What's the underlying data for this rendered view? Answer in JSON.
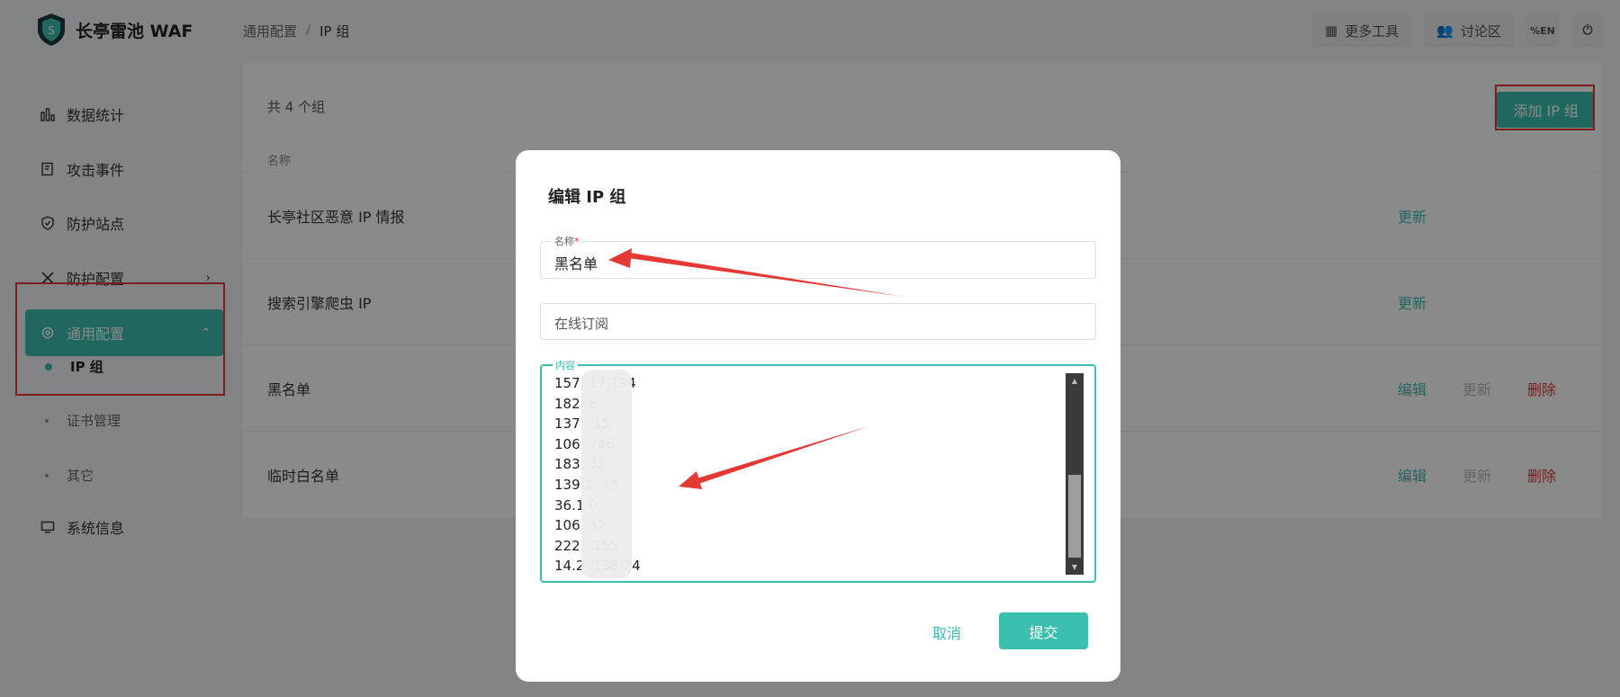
{
  "header": {
    "app_name": "长亭雷池 WAF",
    "breadcrumb": [
      "通用配置",
      "IP 组"
    ],
    "tools": [
      {
        "label": "更多工具",
        "icon": "apps-icon"
      },
      {
        "label": "讨论区",
        "icon": "community-icon"
      }
    ],
    "lang_icon": "%EN",
    "logout_icon": "logout-icon"
  },
  "sidebar": {
    "items": [
      {
        "label": "数据统计",
        "icon": "chart-icon"
      },
      {
        "label": "攻击事件",
        "icon": "event-icon"
      },
      {
        "label": "防护站点",
        "icon": "shield-icon"
      },
      {
        "label": "防护配置",
        "icon": "tools-icon"
      },
      {
        "label": "通用配置",
        "icon": "settings-icon"
      },
      {
        "label": "系统信息",
        "icon": "monitor-icon"
      }
    ],
    "sub_items": [
      "IP 组",
      "证书管理",
      "其它"
    ]
  },
  "main": {
    "count_text": "共 4 个组",
    "add_button": "添加 IP 组",
    "column_name": "名称",
    "rows": [
      {
        "name": "长亭社区恶意 IP 情报",
        "update": "更新"
      },
      {
        "name": "搜索引擎爬虫 IP",
        "update": "更新"
      },
      {
        "name": "黑名单",
        "edit": "编辑",
        "update": "更新",
        "delete": "删除"
      },
      {
        "name": "临时白名单",
        "edit": "编辑",
        "update": "更新",
        "delete": "删除"
      }
    ]
  },
  "modal": {
    "title": "编辑 IP 组",
    "name_label": "名称",
    "name_required": "*",
    "name_value": "黑名单",
    "subscribe_placeholder": "在线订阅",
    "content_label": "内容",
    "ip_lines": [
      "157.    17.194",
      "182.        6",
      "137.       .15",
      "106.      246",
      "183.        32",
      "139.1      .45",
      "36.1        0",
      "106.        32",
      "222.      .155",
      "14.2      .138/24"
    ],
    "cancel": "取消",
    "submit": "提交"
  },
  "colors": {
    "accent": "#3bbfb0",
    "danger": "#e53935",
    "annotation": "#e53935"
  }
}
